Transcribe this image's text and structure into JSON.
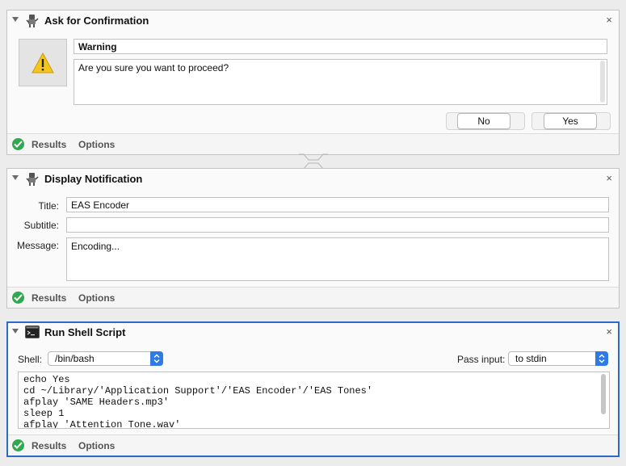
{
  "panels": {
    "confirm": {
      "title": "Ask for Confirmation",
      "close": "×",
      "heading": "Warning",
      "message": "Are you sure you want to proceed?",
      "no_label": "No",
      "yes_label": "Yes"
    },
    "notify": {
      "title": "Display Notification",
      "close": "×",
      "title_label": "Title:",
      "title_value": "EAS Encoder",
      "subtitle_label": "Subtitle:",
      "subtitle_value": "",
      "message_label": "Message:",
      "message_value": "Encoding..."
    },
    "shell": {
      "title": "Run Shell Script",
      "close": "×",
      "shell_label": "Shell:",
      "shell_value": "/bin/bash",
      "pass_label": "Pass input:",
      "pass_value": "to stdin",
      "script_lines": [
        "echo Yes",
        "cd ~/Library/'Application Support'/'EAS Encoder'/'EAS Tones'",
        "afplay 'SAME Headers.mp3'",
        "sleep 1",
        "afplay 'Attention Tone.wav'"
      ]
    }
  },
  "footer": {
    "results_label": "Results",
    "options_label": "Options"
  },
  "colors": {
    "accent": "#2f7ae5",
    "selected_border": "#2a6ac8",
    "success": "#2fa84f",
    "warning": "#f4c51b"
  },
  "icons": {
    "action": "automator-robot-icon",
    "terminal": "terminal-icon",
    "warning": "warning-icon",
    "status": "checkmark-icon"
  }
}
